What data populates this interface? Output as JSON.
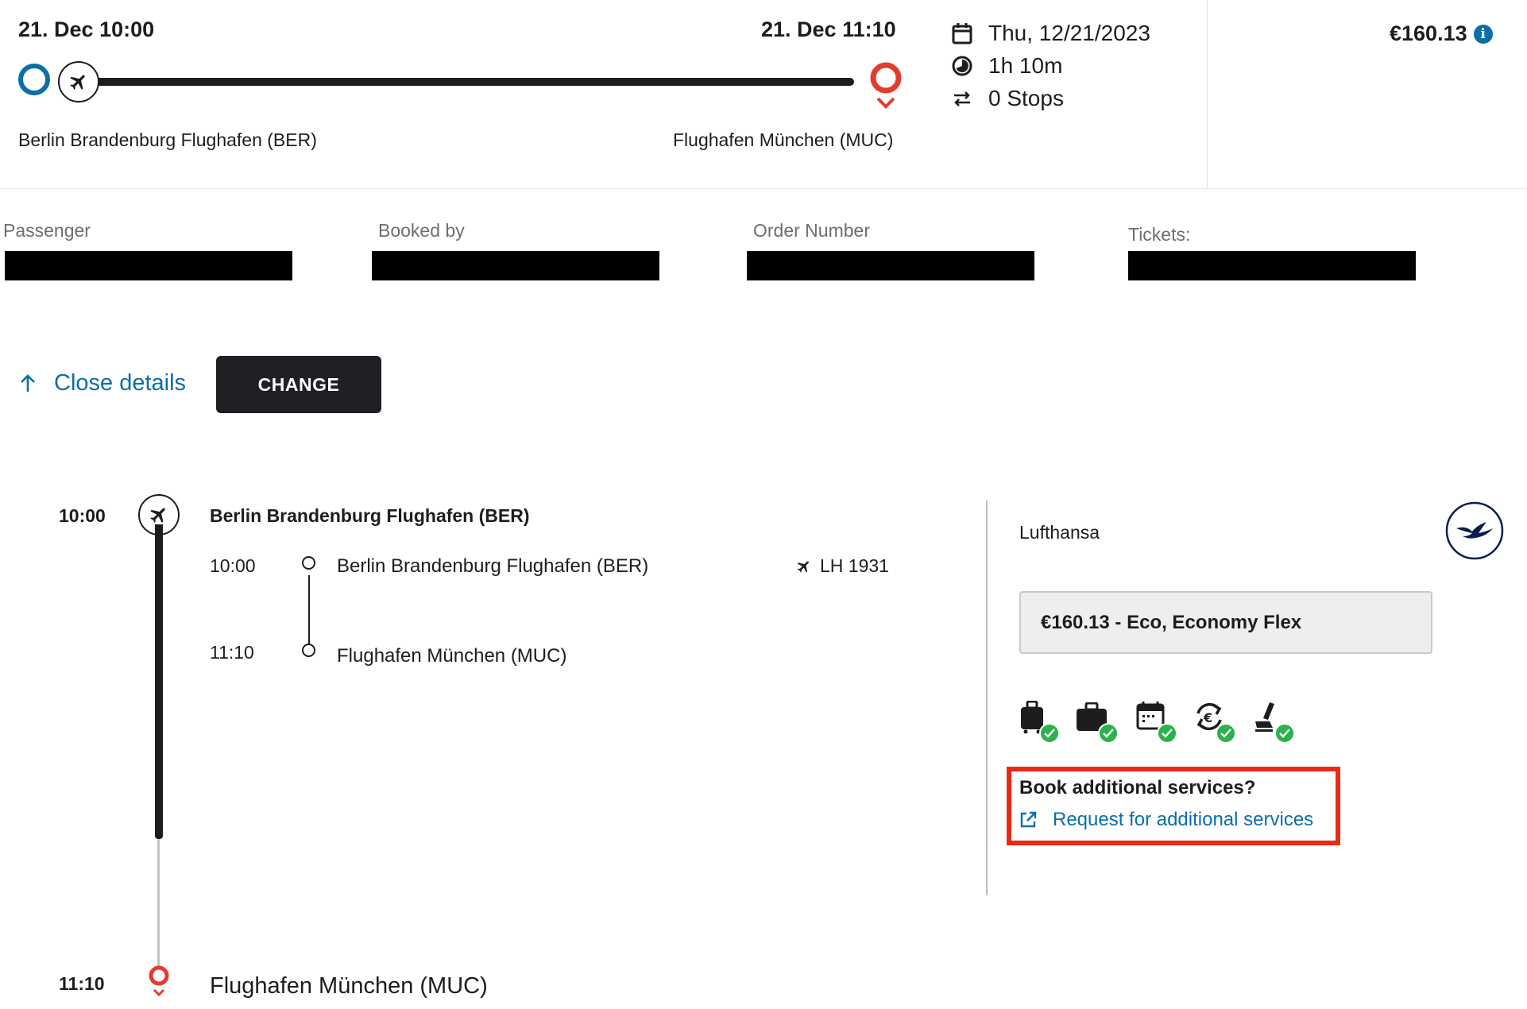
{
  "summary": {
    "departure_datetime": "21. Dec 10:00",
    "arrival_datetime": "21. Dec 11:10",
    "origin": "Berlin Brandenburg Flughafen (BER)",
    "destination": "Flughafen München (MUC)",
    "date": "Thu, 12/21/2023",
    "duration": "1h 10m",
    "stops": "0 Stops",
    "price": "€160.13"
  },
  "booking_info": {
    "passenger_label": "Passenger",
    "booked_by_label": "Booked by",
    "order_number_label": "Order Number",
    "tickets_label": "Tickets:"
  },
  "actions": {
    "close_details": "Close details",
    "change": "CHANGE"
  },
  "itinerary": {
    "departure_time": "10:00",
    "departure_airport": "Berlin Brandenburg Flughafen (BER)",
    "segment": {
      "dep_time": "10:00",
      "dep_airport": "Berlin Brandenburg Flughafen (BER)",
      "arr_time": "11:10",
      "arr_airport": "Flughafen München (MUC)",
      "flight_number": "LH 1931"
    },
    "arrival_time": "11:10",
    "arrival_airport": "Flughafen München (MUC)"
  },
  "fare_panel": {
    "airline": "Lufthansa",
    "fare": "€160.13 - Eco, Economy Flex",
    "amenities": [
      "carry-on-bag-icon",
      "checked-bag-icon",
      "rebooking-calendar-icon",
      "refund-euro-icon",
      "seat-selection-icon"
    ],
    "additional_services_title": "Book additional services?",
    "additional_services_link": "Request for additional services"
  },
  "colors": {
    "accent_blue": "#0a6ea8",
    "dark": "#1d1d1f",
    "destination_red": "#e53b2c",
    "check_green": "#2bb24c",
    "highlight_red": "#ea2a12"
  }
}
